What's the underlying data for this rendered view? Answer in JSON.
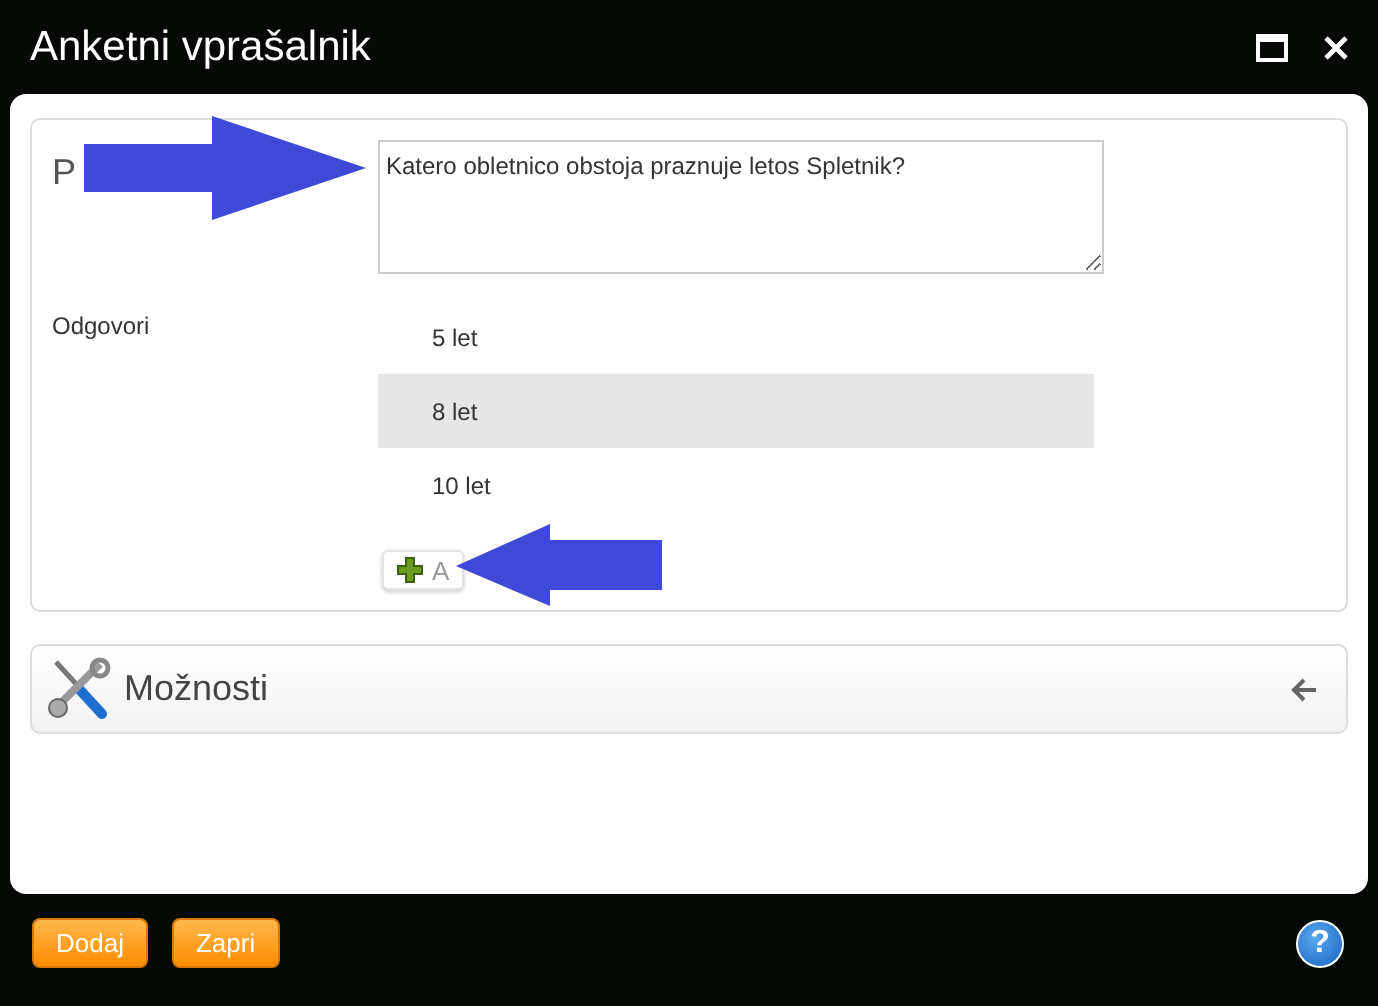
{
  "window": {
    "title": "Anketni vprašalnik"
  },
  "question": {
    "label": "P",
    "value": "Katero obletnico obstoja praznuje letos Spletnik?"
  },
  "answers": {
    "label": "Odgovori",
    "items": [
      {
        "text": "5 let",
        "selected": false
      },
      {
        "text": "8 let",
        "selected": true
      },
      {
        "text": "10 let",
        "selected": false
      }
    ],
    "add_button": "A"
  },
  "options": {
    "title": "Možnosti",
    "expanded": false
  },
  "footer": {
    "buttons": [
      "Dodaj",
      "Zapri"
    ],
    "help": "?"
  }
}
